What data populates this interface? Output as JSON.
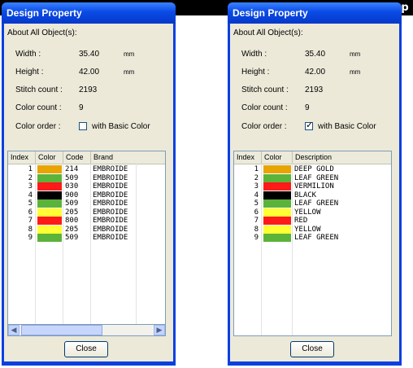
{
  "caption_left": "",
  "caption_right": "p",
  "colors": {
    "title_bar": "#0a3fe0",
    "dialog_bg": "#ece9d8",
    "orange": "#e8a400",
    "green": "#5bb33a",
    "red": "#ff1a1a",
    "black": "#000000",
    "yellow": "#ffff33"
  },
  "left_dialog": {
    "title": "Design Property",
    "about": "About All Object(s):",
    "width_label": "Width :",
    "width_value": "35.40",
    "width_unit": "mm",
    "height_label": "Height :",
    "height_value": "42.00",
    "height_unit": "mm",
    "stitch_label": "Stitch count :",
    "stitch_value": "2193",
    "color_count_label": "Color count :",
    "color_count_value": "9",
    "color_order_label": "Color order :",
    "basic_color_label": "with Basic Color",
    "basic_color_checked": false,
    "columns": [
      "Index",
      "Color",
      "Code",
      "Brand"
    ],
    "rows": [
      {
        "index": "1",
        "color": "#e8a400",
        "code": "214",
        "brand": "EMBROIDE"
      },
      {
        "index": "2",
        "color": "#5bb33a",
        "code": "509",
        "brand": "EMBROIDE"
      },
      {
        "index": "3",
        "color": "#ff1a1a",
        "code": "030",
        "brand": "EMBROIDE"
      },
      {
        "index": "4",
        "color": "#000000",
        "code": "900",
        "brand": "EMBROIDE"
      },
      {
        "index": "5",
        "color": "#5bb33a",
        "code": "509",
        "brand": "EMBROIDE"
      },
      {
        "index": "6",
        "color": "#ffff33",
        "code": "205",
        "brand": "EMBROIDE"
      },
      {
        "index": "7",
        "color": "#ff1a1a",
        "code": "800",
        "brand": "EMBROIDE"
      },
      {
        "index": "8",
        "color": "#ffff33",
        "code": "205",
        "brand": "EMBROIDE"
      },
      {
        "index": "9",
        "color": "#5bb33a",
        "code": "509",
        "brand": "EMBROIDE"
      }
    ],
    "close_label": "Close"
  },
  "right_dialog": {
    "title": "Design Property",
    "about": "About All Object(s):",
    "width_label": "Width :",
    "width_value": "35.40",
    "width_unit": "mm",
    "height_label": "Height :",
    "height_value": "42.00",
    "height_unit": "mm",
    "stitch_label": "Stitch count :",
    "stitch_value": "2193",
    "color_count_label": "Color count :",
    "color_count_value": "9",
    "color_order_label": "Color order :",
    "basic_color_label": "with Basic Color",
    "basic_color_checked": true,
    "columns": [
      "Index",
      "Color",
      "Description"
    ],
    "rows": [
      {
        "index": "1",
        "color": "#e8a400",
        "description": "DEEP GOLD"
      },
      {
        "index": "2",
        "color": "#5bb33a",
        "description": "LEAF GREEN"
      },
      {
        "index": "3",
        "color": "#ff1a1a",
        "description": "VERMILION"
      },
      {
        "index": "4",
        "color": "#000000",
        "description": "BLACK"
      },
      {
        "index": "5",
        "color": "#5bb33a",
        "description": "LEAF GREEN"
      },
      {
        "index": "6",
        "color": "#ffff33",
        "description": "YELLOW"
      },
      {
        "index": "7",
        "color": "#ff1a1a",
        "description": "RED"
      },
      {
        "index": "8",
        "color": "#ffff33",
        "description": "YELLOW"
      },
      {
        "index": "9",
        "color": "#5bb33a",
        "description": "LEAF GREEN"
      }
    ],
    "close_label": "Close"
  }
}
